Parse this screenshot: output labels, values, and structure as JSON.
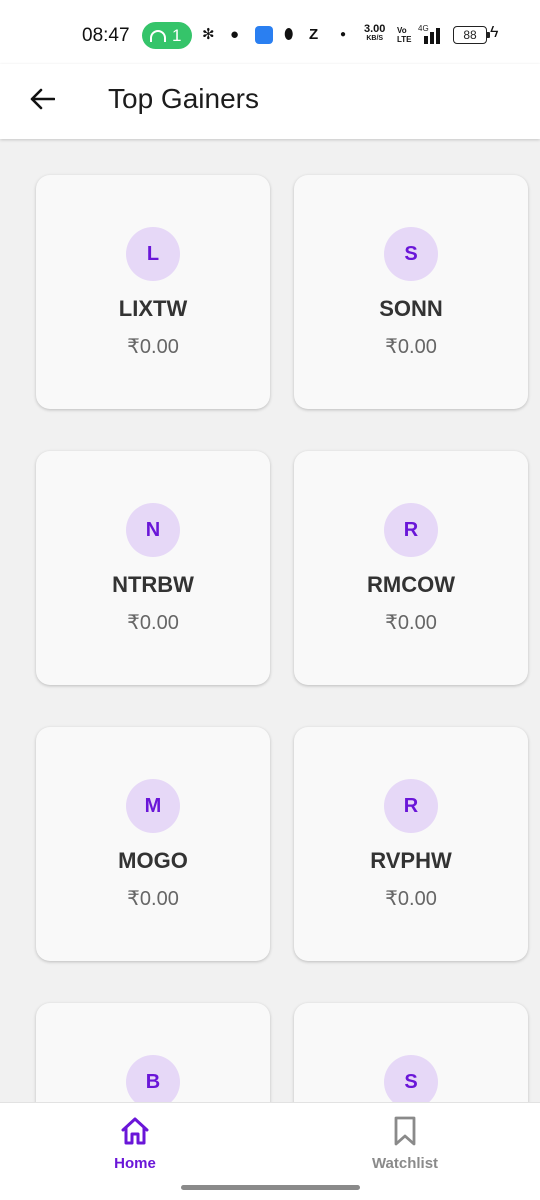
{
  "status_bar": {
    "time": "08:47",
    "hotspot_count": "1",
    "net_speed": "3.00",
    "net_speed_unit": "KB/S",
    "network_type": "4G",
    "lte_label": "Vo LTE",
    "battery": "88"
  },
  "header": {
    "title": "Top Gainers"
  },
  "stocks": [
    {
      "initial": "L",
      "symbol": "LIXTW",
      "price": "₹0.00"
    },
    {
      "initial": "S",
      "symbol": "SONN",
      "price": "₹0.00"
    },
    {
      "initial": "N",
      "symbol": "NTRBW",
      "price": "₹0.00"
    },
    {
      "initial": "R",
      "symbol": "RMCOW",
      "price": "₹0.00"
    },
    {
      "initial": "M",
      "symbol": "MOGO",
      "price": "₹0.00"
    },
    {
      "initial": "R",
      "symbol": "RVPHW",
      "price": "₹0.00"
    },
    {
      "initial": "B",
      "symbol": "",
      "price": ""
    },
    {
      "initial": "S",
      "symbol": "",
      "price": ""
    }
  ],
  "bottom_nav": {
    "home_label": "Home",
    "watchlist_label": "Watchlist",
    "home_icon": "home-icon",
    "watchlist_icon": "bookmark-icon"
  },
  "colors": {
    "accent": "#6a16d8",
    "avatar_bg": "#e6d8f7",
    "card_bg": "#f9f9f9",
    "page_bg": "#f1f1f1",
    "hotspot_green": "#35c46a"
  }
}
